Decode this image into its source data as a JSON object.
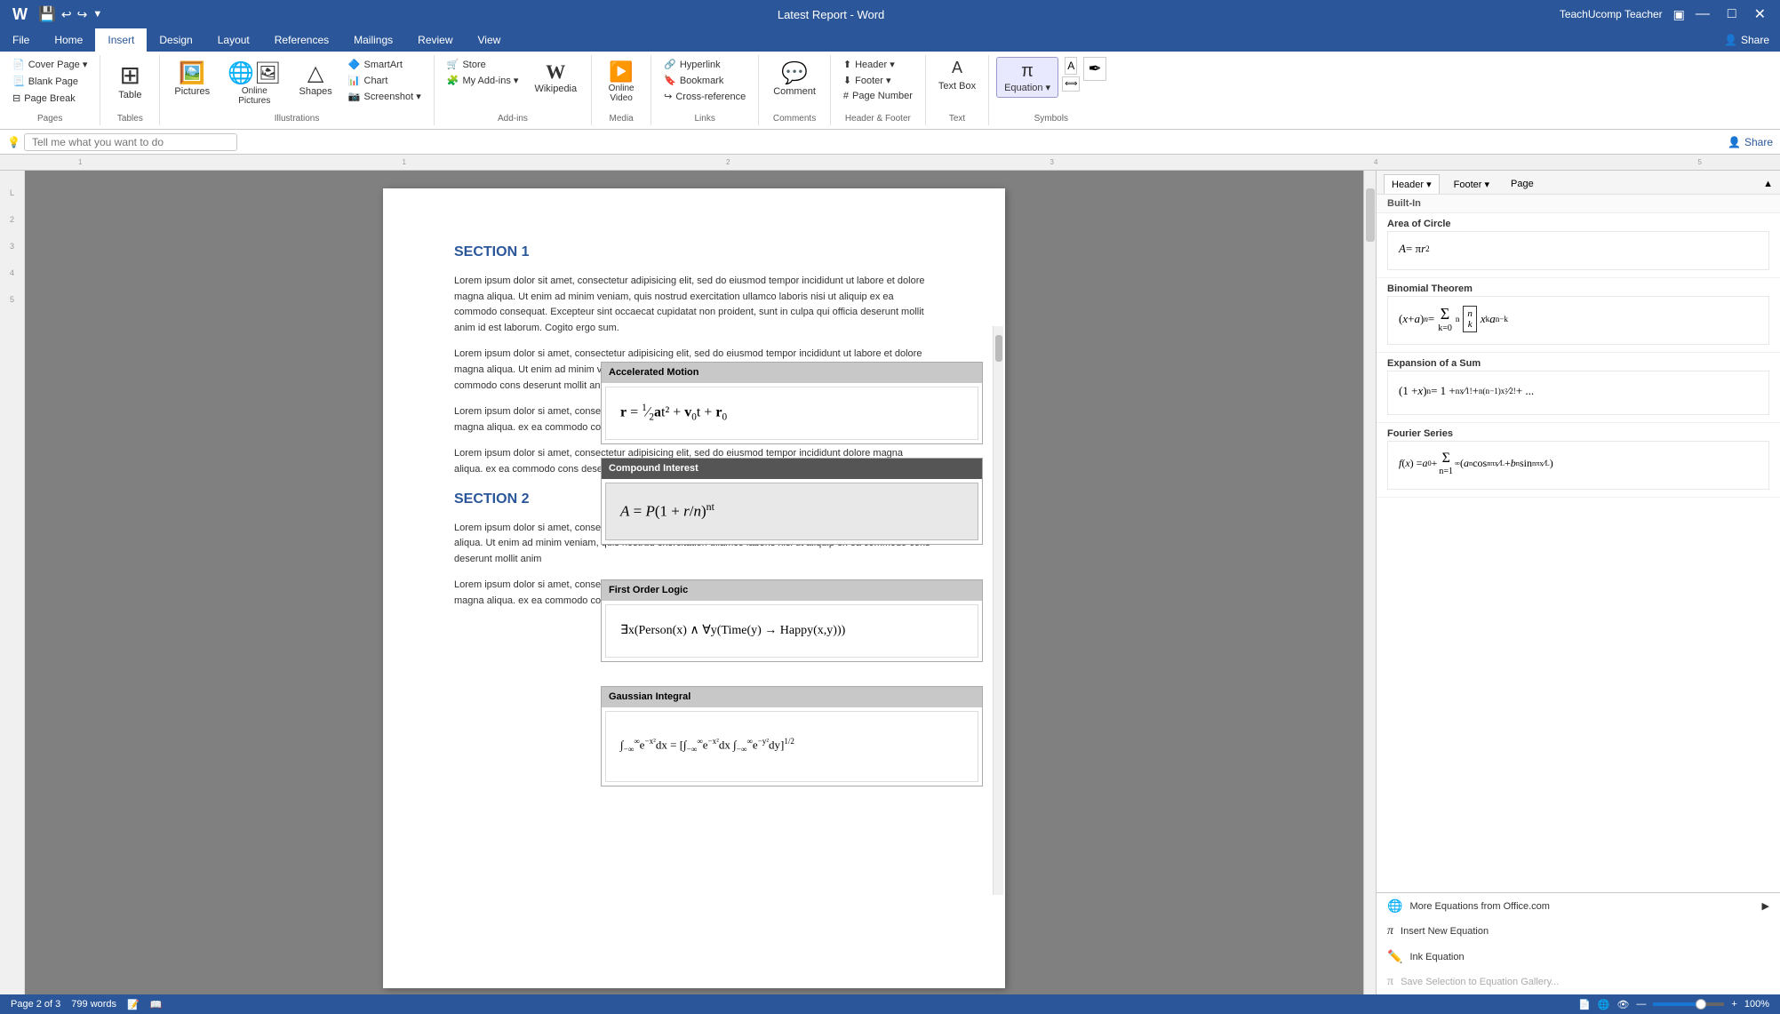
{
  "titleBar": {
    "appTitle": "Latest Report - Word",
    "user": "TeachUcomp Teacher",
    "saveIcon": "💾",
    "undoIcon": "↩",
    "redoIcon": "↪"
  },
  "ribbonTabs": [
    {
      "label": "File",
      "active": false
    },
    {
      "label": "Home",
      "active": false
    },
    {
      "label": "Insert",
      "active": true
    },
    {
      "label": "Design",
      "active": false
    },
    {
      "label": "Layout",
      "active": false
    },
    {
      "label": "References",
      "active": false
    },
    {
      "label": "Mailings",
      "active": false
    },
    {
      "label": "Review",
      "active": false
    },
    {
      "label": "View",
      "active": false
    }
  ],
  "ribbon": {
    "groups": {
      "pages": {
        "label": "Pages",
        "buttons": [
          "Cover Page",
          "Blank Page",
          "Page Break"
        ]
      },
      "tables": {
        "label": "Tables",
        "button": "Table"
      },
      "illustrations": {
        "label": "Illustrations",
        "buttons": [
          "Pictures",
          "Online Pictures",
          "Shapes",
          "SmartArt",
          "Chart",
          "Screenshot"
        ]
      },
      "addins": {
        "label": "Add-ins",
        "buttons": [
          "Store",
          "My Add-ins",
          "Wikipedia"
        ]
      },
      "media": {
        "label": "Media",
        "button": "Online Video"
      },
      "links": {
        "label": "Links",
        "buttons": [
          "Hyperlink",
          "Bookmark",
          "Cross-reference"
        ]
      },
      "comments": {
        "label": "Comments",
        "button": "Comment"
      },
      "headerFooter": {
        "label": "Header & Footer",
        "buttons": [
          "Header",
          "Footer",
          "Page Number"
        ]
      },
      "equation": {
        "label": "Equation",
        "button": "π Equation"
      }
    }
  },
  "searchBar": {
    "placeholder": "Tell me what you want to do"
  },
  "document": {
    "section1Title": "SECTION 1",
    "section1Text1": "Lorem ipsum dolor sit amet, consectetur adipisicing elit, sed do eiusmod tempor incididunt ut labore et dolore magna aliqua. Ut enim ad minim veniam, quis nostrud exercitation ullamco laboris nisi ut aliquip ex ea commodo consequat. Excepteur sint occaecat cupidatat non proident, sunt in culpa qui officia deserunt mollit anim id est laborum. Cogito ergo sum.",
    "section1Text2": "Lorem ipsum dolor sit amet, consectetur adipisicing elit, sed do eiusmod tempor incididunt ut labore et dolore magna aliqua. Ut enim ad minim veniam, quis nostrud exercitation ullamco laboris nisi ut aliquip ex ea commodo cons deserunt mollit anim",
    "section1Text3": "Lorem ipsum dolor si amet, consectetur adipisicing elit, sed do eiusmod tempor incididunt dolore magna aliqua. ex ea commodo cons deserunt mollit anim",
    "section1Text4": "Lorem ipsum dolor si amet, consectetur adipisicing elit, sed do eiusmod tempor incididunt dolore magna aliqua. ex ea commodo cons deserunt mollit anim",
    "section2Title": "SECTION 2",
    "section2Text1": "Lorem ipsum dolor si amet, consectetur adipisicing elit, sed do eiusmod tempor incididunt dolore magna aliqua. Ut enim ad minim veniam, quis nostrud exercitation ullamco laboris nisi ut aliquip ex ea commodo cons deserunt mollit anim"
  },
  "statusBar": {
    "page": "Page 2 of 3",
    "words": "799 words",
    "zoom": "100%"
  },
  "floatingPanels": [
    {
      "title": "Accelerated Motion",
      "formula": "r = ½at² + v₀t + r₀",
      "selected": false
    },
    {
      "title": "Compound Interest",
      "formula": "A = P(1 + r/n)^(nt)",
      "selected": true
    },
    {
      "title": "First Order Logic",
      "formula": "∃x(Person(x) ∧ ∀y(Time(y) → Happy(x,y)))"
    },
    {
      "title": "Gaussian Integral",
      "formula": "∫e^(−x²)dx = [∫e^(−x²)dx ∫e^(−y²)dy]^(1/2)"
    }
  ],
  "rightPanel": {
    "builtInLabel": "Built-In",
    "equations": [
      {
        "name": "Area of Circle",
        "formula": "A = πr²"
      },
      {
        "name": "Binomial Theorem",
        "formula": "(x + a)ⁿ = Σ(k=0 to n) C(n,k) xᵏaⁿ⁻ᵏ"
      },
      {
        "name": "Expansion of a Sum",
        "formula": "(1 + x)ⁿ = 1 + nx/1! + n(n−1)x²/2! + ..."
      },
      {
        "name": "Fourier Series",
        "formula": "f(x) = a₀ + Σ(n=1 to ∞)(aₙcos(nπx/L) + bₙsin(nπx/L))"
      }
    ],
    "menuItems": [
      {
        "label": "More Equations from Office.com",
        "icon": "🌐",
        "disabled": false
      },
      {
        "label": "Insert New Equation",
        "icon": "π",
        "disabled": false
      },
      {
        "label": "Ink Equation",
        "icon": "✏️",
        "disabled": false
      },
      {
        "label": "Save Selection to Equation Gallery...",
        "icon": "π",
        "disabled": true
      }
    ]
  }
}
